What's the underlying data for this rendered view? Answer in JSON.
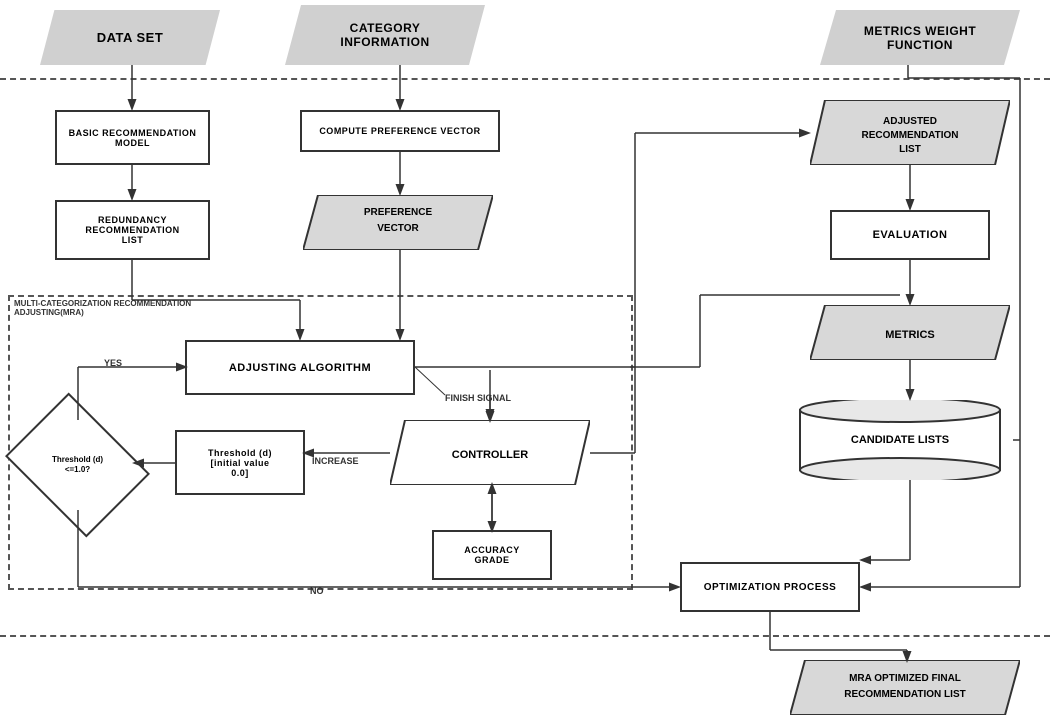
{
  "headers": {
    "dataset": "DATA SET",
    "category": "CATEGORY\nINFORMATION",
    "metrics": "METRICS WEIGHT\nFUNCTION"
  },
  "boxes": {
    "basic_rec": "BASIC RECOMMENDATION\nMODEL",
    "redundancy": "REDUNDANCY\nRECOMMENDATION\nLIST",
    "compute_pref": "COMPUTE PREFERENCE VECTOR",
    "pref_vector": "PREFERENCE\nVECTOR",
    "adjusting_algo": "ADJUSTING ALGORITHM",
    "threshold_box": "Threshold (d)\n[initial value\n0.0]",
    "controller": "CONTROLLER",
    "accuracy": "ACCURACY\nGRADE",
    "adjusted_rec": "ADJUSTED\nRECOMMENDATION\nLIST",
    "evaluation": "EVALUATION",
    "metrics": "METRICS",
    "candidate_lists": "CANDIDATE LISTS",
    "optimization": "OPTIMIZATION PROCESS",
    "mra_final": "MRA OPTIMIZED FINAL\nRECOMMENDATION LIST",
    "mra_label": "MULTI-CATEGORIZATION RECOMMENDATION\nADJUSTING(MRA)",
    "threshold_diamond": "Threshold (d)\n<=1.0?",
    "yes_label": "YES",
    "no_label": "NO",
    "increase_label": "INCREASE",
    "finish_signal": "FINISH SIGNAL"
  }
}
